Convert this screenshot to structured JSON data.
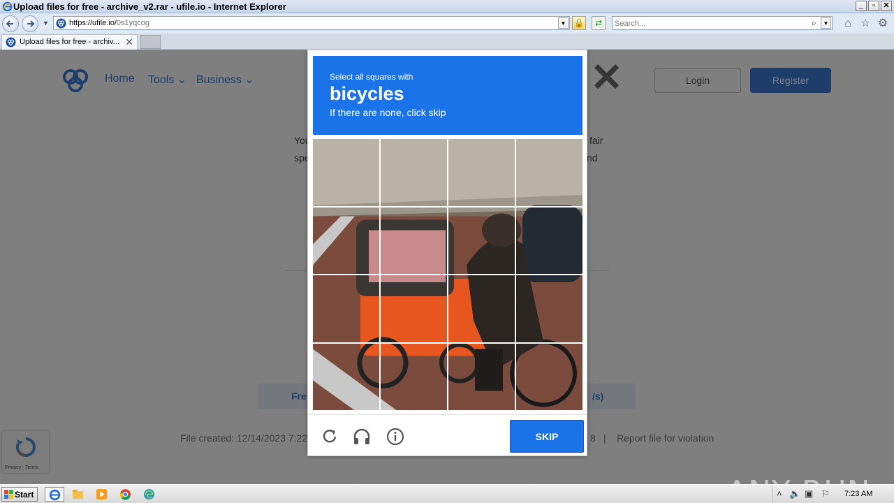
{
  "window": {
    "title": "Upload files for free - archive_v2.rar - ufile.io - Internet Explorer",
    "min": "_",
    "max": "▫",
    "close": "✕"
  },
  "address_bar": {
    "url_host": "https://ufile.io/",
    "url_path": "0s1yqcog",
    "search_placeholder": "Search..."
  },
  "tab": {
    "label": "Upload files for free - archiv...",
    "close": "✕"
  },
  "site": {
    "nav": [
      "Home",
      "Tools ⌄",
      "Business ⌄"
    ],
    "login": "Login",
    "register": "Register",
    "modal_fragments": [
      "You",
      "fair",
      "spe",
      "nd"
    ],
    "free_label": "Fre",
    "speed_label": "/s)",
    "file_created": "File created: 12/14/2023 7:22",
    "footer_mid": "8",
    "footer_sep": "|",
    "report": "Report file for violation",
    "recaptcha_badge": "Privacy - Terms"
  },
  "captcha": {
    "line1": "Select all squares with",
    "target": "bicycles",
    "line3": "If there are none, click skip",
    "skip": "SKIP",
    "tiles": 16
  },
  "taskbar": {
    "start": "Start",
    "clock": "7:23 AM"
  },
  "watermark": "ANY RUN",
  "colors": {
    "captcha_blue": "#1a73e8",
    "site_blue": "#3c7bd6"
  }
}
